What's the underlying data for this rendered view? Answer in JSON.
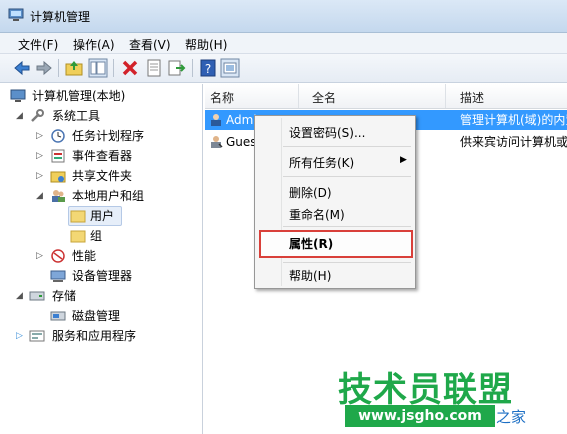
{
  "window": {
    "title": "计算机管理"
  },
  "menu": [
    "文件(F)",
    "操作(A)",
    "查看(V)",
    "帮助(H)"
  ],
  "toolbar": {
    "icons": [
      "back-arrow-icon",
      "forward-arrow-icon",
      "up-folder-icon",
      "show-tree-icon",
      "delete-icon",
      "properties-icon",
      "export-icon",
      "help-icon",
      "view-icon"
    ]
  },
  "tree": {
    "root": "计算机管理(本地)",
    "system_tools": "系统工具",
    "task_scheduler": "任务计划程序",
    "event_viewer": "事件查看器",
    "shared_folders": "共享文件夹",
    "local_users": "本地用户和组",
    "users": "用户",
    "groups": "组",
    "performance": "性能",
    "device_manager": "设备管理器",
    "storage": "存储",
    "disk_management": "磁盘管理",
    "services": "服务和应用程序"
  },
  "list": {
    "columns": [
      "名称",
      "全名",
      "描述"
    ],
    "rows": [
      {
        "name": "Admi",
        "description": "管理计算机(域)的内置"
      },
      {
        "name": "Gues",
        "description": "供来宾访问计算机或"
      }
    ]
  },
  "context_menu": {
    "set_password": "设置密码(S)...",
    "all_tasks": "所有任务(K)",
    "delete": "删除(D)",
    "rename": "重命名(M)",
    "properties": "属性(R)",
    "help": "帮助(H)"
  },
  "watermark": {
    "brand": "技术员联盟",
    "url": "www.jsgho.com",
    "tail": "之家"
  },
  "colors": {
    "selection": "#3399ff",
    "highlight_border": "#d9403a",
    "watermark_green": "#1fa84a"
  }
}
